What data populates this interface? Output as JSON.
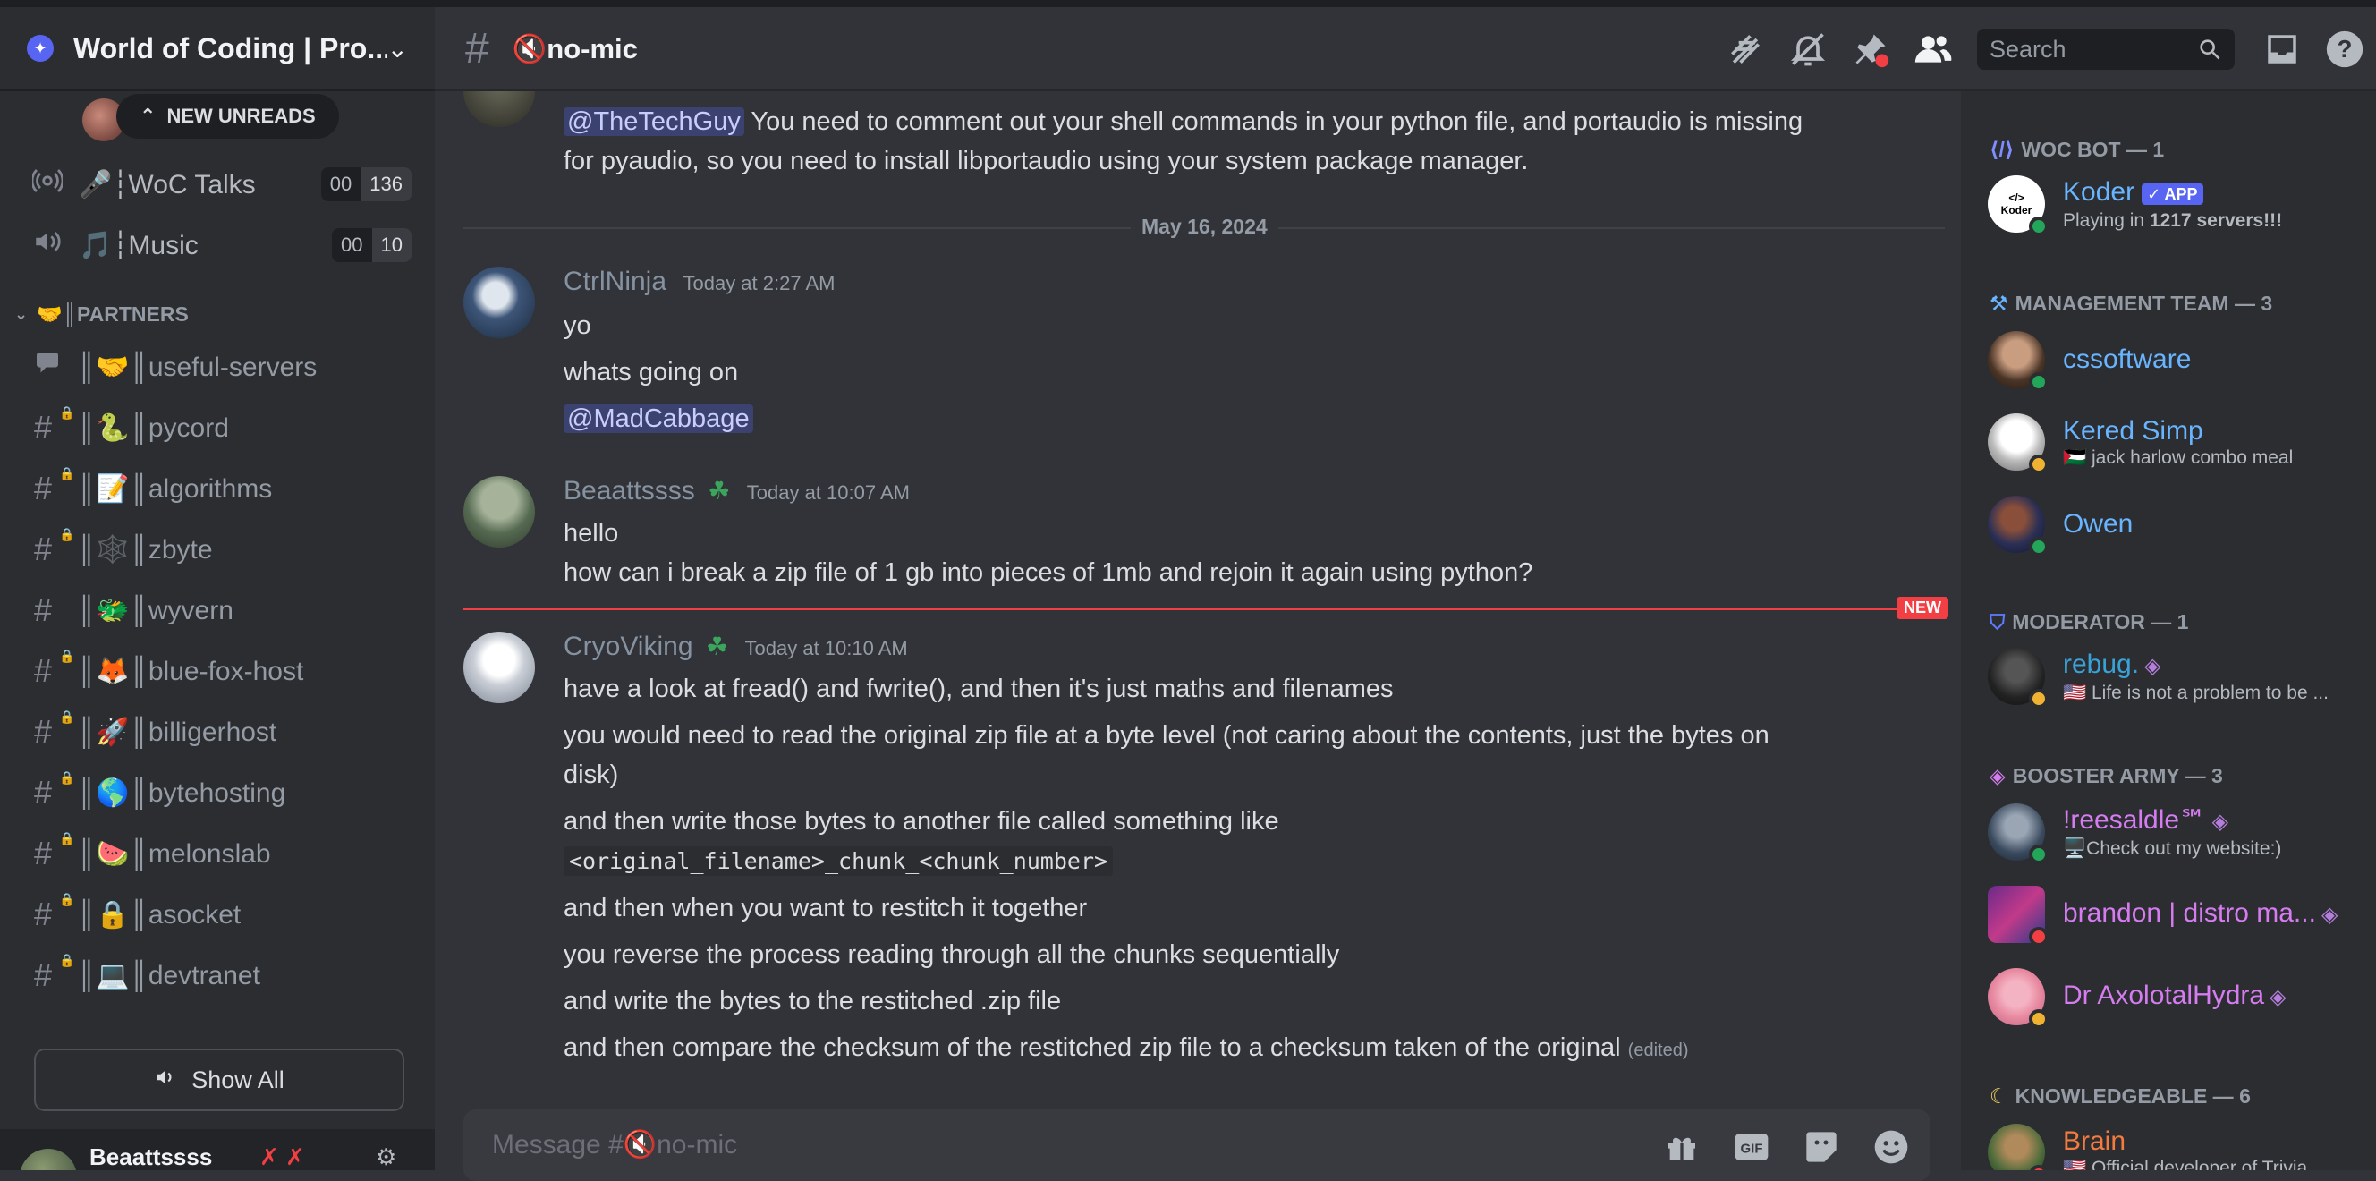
{
  "server": {
    "name": "World of Coding | Pro...",
    "unreads_label": "NEW UNREADS"
  },
  "voice_channels": [
    {
      "name": "🎤┆WoC Talks",
      "count_a": "00",
      "count_b": "136",
      "icon": "broadcast-icon"
    },
    {
      "name": "🎵┆Music",
      "count_a": "00",
      "count_b": "10",
      "icon": "speaker-icon"
    }
  ],
  "category": {
    "label": "🤝║PARTNERS"
  },
  "channels": [
    {
      "name": "║🤝║useful-servers",
      "icon": "forum-icon"
    },
    {
      "name": "║🐍║pycord",
      "icon": "locked-hash-icon"
    },
    {
      "name": "║📝║algorithms",
      "icon": "locked-hash-icon"
    },
    {
      "name": "║🕸️║zbyte",
      "icon": "locked-hash-icon"
    },
    {
      "name": "║🐲║wyvern",
      "icon": "hash-icon"
    },
    {
      "name": "║🦊║blue-fox-host",
      "icon": "locked-hash-icon"
    },
    {
      "name": "║🚀║billigerhost",
      "icon": "locked-hash-icon"
    },
    {
      "name": "║🌎║bytehosting",
      "icon": "locked-hash-icon"
    },
    {
      "name": "║🍉║melonslab",
      "icon": "locked-hash-icon"
    },
    {
      "name": "║🔒║asocket",
      "icon": "locked-hash-icon"
    },
    {
      "name": "║💻║devtranet",
      "icon": "locked-hash-icon"
    }
  ],
  "show_all": "Show All",
  "user": {
    "name": "Beaattssss"
  },
  "channel_header": {
    "title": "🔇no-mic",
    "search_placeholder": "Search"
  },
  "messages": {
    "top_mention": "@TheTechGuy",
    "top_text_1": " You need to comment out your shell commands in your python file, and portaudio is missing",
    "top_text_2": "for pyaudio, so you need to install libportaudio using your system package manager.",
    "date_divider": "May 16, 2024",
    "group1": {
      "author": "CtrlNinja",
      "time": "Today at 2:27 AM",
      "lines": [
        "yo",
        "whats going on"
      ],
      "mention": "@MadCabbage"
    },
    "group2": {
      "author": "Beaattssss",
      "time": "Today at 10:07 AM",
      "lines": [
        "hello",
        "how can i break a zip file of 1 gb into pieces of 1mb and rejoin it again using python?"
      ]
    },
    "new_badge": "NEW",
    "group3": {
      "author": "CryoViking",
      "time": "Today at 10:10 AM",
      "line1": "have a look at fread() and fwrite(), and then it's just maths and filenames",
      "line2a": "you would need to read the original zip file at a byte level (not caring about the contents, just the bytes on",
      "line2b": "disk)",
      "line3": "and then write those bytes to another file called something like",
      "code": "<original_filename>_chunk_<chunk_number>",
      "line4": "and then when you want to restitch it together",
      "line5": "you reverse the process reading through all the chunks sequentially",
      "line6": "and write the bytes to the restitched .zip file",
      "line7": "and then compare the checksum of the restitched zip file to a checksum taken of the original",
      "edited": "(edited)"
    }
  },
  "composer": {
    "placeholder": "Message #🔇no-mic"
  },
  "members": {
    "groups": {
      "bot": "WOC BOT — 1",
      "mgmt": "MANAGEMENT TEAM — 3",
      "mod": "MODERATOR — 1",
      "booster": "BOOSTER ARMY — 3",
      "knowledge": "KNOWLEDGEABLE — 6"
    },
    "koder": {
      "name": "Koder",
      "badge": "✓ APP",
      "sub_prefix": "Playing in ",
      "sub": "1217 servers!!!",
      "avatar_text": "</>\nKoder"
    },
    "cssoftware": {
      "name": "cssoftware"
    },
    "kered": {
      "name": "Kered Simp",
      "sub": "🇵🇸 jack harlow combo meal"
    },
    "owen": {
      "name": "Owen"
    },
    "rebug": {
      "name": "rebug.",
      "sub": "🇺🇸 Life is not a problem to be ..."
    },
    "reesaldle": {
      "name": "!reesaldle℠",
      "sub": "🖥️Check out my website:)"
    },
    "brandon": {
      "name": "brandon | distro ma..."
    },
    "axolotl": {
      "name": "Dr AxolotalHydra"
    },
    "brain": {
      "name": "Brain",
      "sub": "🇺🇸 Official developer of Trivia..."
    }
  },
  "colors": {
    "background": "#313338",
    "sidebar": "#2b2d31",
    "accent": "#5865f2",
    "online": "#23a55a",
    "idle": "#f0b232",
    "dnd": "#f23f43",
    "role_mgmt": "#69b4ff",
    "role_booster": "#d57cf0",
    "role_knowledge": "#f47b3f"
  }
}
